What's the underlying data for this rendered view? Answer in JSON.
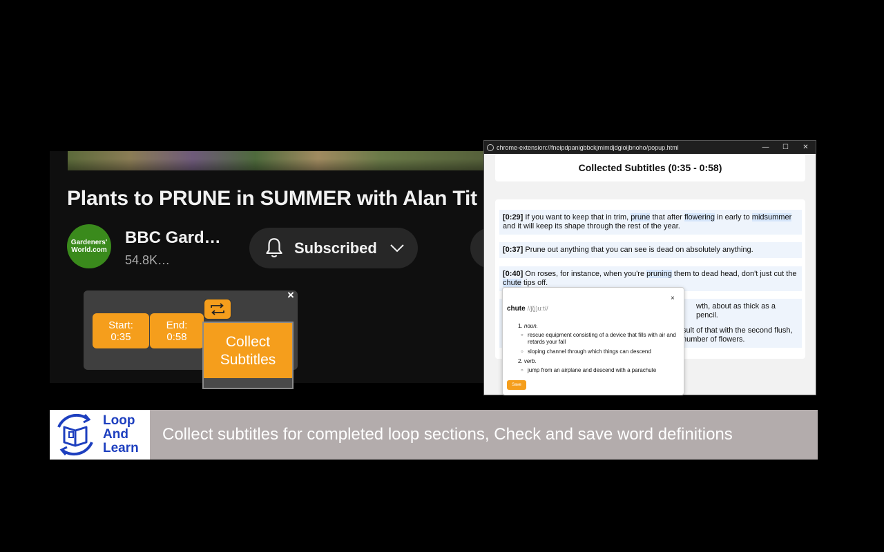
{
  "video": {
    "title": "Plants to PRUNE in SUMMER with Alan Tit",
    "channel_name": "BBC Gard…",
    "channel_subs": "54.8K…",
    "avatar_text": "Gardeners' World.com",
    "subscribe_label": "Subscribed"
  },
  "loop_widget": {
    "close_symbol": "×",
    "start_label": "Start:",
    "start_value": "0:35",
    "end_label": "End:",
    "end_value": "0:58",
    "collect_label_line1": "Collect",
    "collect_label_line2": "Subtitles"
  },
  "popup": {
    "url": "chrome-extension://fneipdpanigbbckjmimdjdgioijbnoho/popup.html",
    "minimize": "—",
    "maximize": "☐",
    "close": "✕",
    "heading": "Collected Subtitles (0:35 - 0:58)",
    "entries": [
      {
        "time": "[0:29]",
        "text_a": " If you want to keep that in trim, ",
        "hl1": "prune",
        "text_b": " that after ",
        "hl2": "flowering",
        "text_c": " in early to ",
        "hl3": "midsummer",
        "text_d": " and it will keep its shape through the rest of the year."
      },
      {
        "time": "[0:37]",
        "text_a": " Prune out anything that you can see is dead on absolutely anything."
      },
      {
        "time": "[0:40]",
        "text_a": " On roses, for instance, when you're ",
        "hl1": "pruning",
        "text_b": " them to dead head, don't just cut the ",
        "hl2": "chute",
        "text_c": " tips off."
      },
      {
        "text_a": "wth, about as thick as a pencil."
      },
      {
        "text_a": "sult of that with the second flush,",
        "text_b": "number of flowers."
      }
    ]
  },
  "dictionary": {
    "close": "×",
    "word": "chute",
    "ipa": "//ʃ(j)uːt//",
    "senses": [
      {
        "num": "1.",
        "pos": "noun.",
        "defs": [
          "rescue equipment consisting of a device that fills with air and retards your fall",
          "sloping channel through which things can descend"
        ]
      },
      {
        "num": "2.",
        "pos": "verb.",
        "defs": [
          "jump from an airplane and descend with a parachute"
        ]
      }
    ],
    "save_label": "Save"
  },
  "banner": {
    "logo_line1": "Loop",
    "logo_line2": "And",
    "logo_line3": "Learn",
    "caption": "Collect subtitles for completed loop sections, Check and save word definitions"
  },
  "colors": {
    "accent": "#f59e1c",
    "brand": "#1d3fbf",
    "banner_bg": "#b3acac"
  }
}
